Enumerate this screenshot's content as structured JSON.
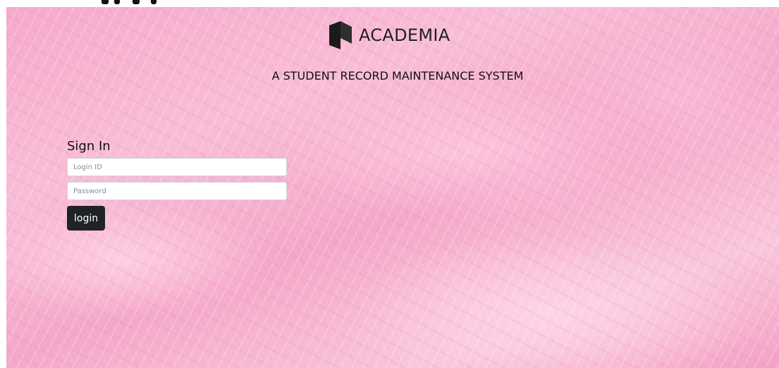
{
  "brand": {
    "name": "ACADEMIA",
    "logo_icon": "academia-logo-icon"
  },
  "tagline": "A STUDENT RECORD MAINTENANCE SYSTEM",
  "signin": {
    "title": "Sign In",
    "login_placeholder": "Login ID",
    "login_value": "",
    "password_placeholder": "Password",
    "password_value": "",
    "button_label": "login"
  },
  "colors": {
    "background_accent": "#f6a9cb",
    "button_bg": "#1f2326",
    "button_text": "#ffffff"
  }
}
